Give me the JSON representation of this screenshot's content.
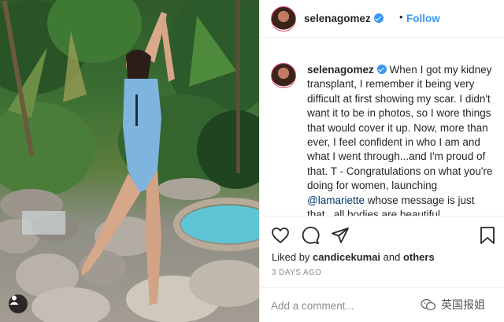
{
  "post": {
    "username": "selenagomez",
    "follow_separator": "•",
    "follow_label": "Follow",
    "caption_user": "selenagomez",
    "caption_pre": " When I got my kidney transplant, I remember it being very difficult at first showing my scar. I didn't want it to be in photos, so I wore things that would cover it up. Now, more than ever, I feel confident in who I am and what I went through...and I'm proud of that. T - Congratulations on what you're doing for women, launching ",
    "caption_mention": "@lamariette",
    "caption_post": " whose message is just that...all bodies are beautiful.",
    "liked_by_prefix": "Liked by ",
    "liked_by_user": "candicekumai",
    "liked_by_and": " and ",
    "liked_by_others": "others",
    "timestamp": "3 DAYS AGO",
    "comment_placeholder": "Add a comment..."
  },
  "watermark": {
    "text": "英国报姐"
  },
  "icons": {
    "verified": "verified-badge-icon",
    "like": "heart-icon",
    "comment": "comment-bubble-icon",
    "share": "paper-plane-icon",
    "save": "bookmark-icon",
    "tagged_users": "user-tag-icon",
    "watermark_logo": "wechat-logo-icon"
  },
  "colors": {
    "link_blue": "#3897f0",
    "mention_blue": "#00376b",
    "muted_gray": "#8e8e8e",
    "text": "#262626",
    "divider": "#efefef"
  }
}
